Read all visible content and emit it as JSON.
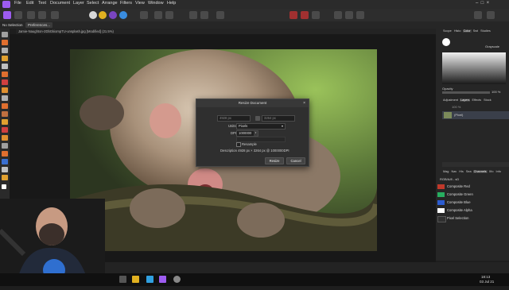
{
  "menu": [
    "File",
    "Edit",
    "Text",
    "Document",
    "Layer",
    "Select",
    "Arrange",
    "Filters",
    "View",
    "Window",
    "Help"
  ],
  "context": {
    "selection": "No Selection",
    "preferences": "Preferences..."
  },
  "tab": {
    "label": "Jamie-Naughton-2DbGkiompTU-unsplash.jpg [Modified] (21.5%)"
  },
  "dialog": {
    "title": "Resize Document",
    "close": "×",
    "width_value": "4928 px",
    "height_value": "3264 px",
    "units_label": "Units",
    "units_value": "Pixels",
    "dpi_label": "DPI",
    "dpi_value": "1000000",
    "resample_label": "Resample",
    "description": "Description 4928 px × 3264 px @ 1000000DPI",
    "resize_button": "Resize",
    "cancel_button": "Cancel"
  },
  "right": {
    "tabs1": [
      "Scope",
      "Histo",
      "Color",
      "Swt",
      "Studies"
    ],
    "grayscale": "Grayscale",
    "opacity_label": "Opacity",
    "opacity_value": "100 %",
    "tabs2": [
      "Adjustment",
      "Layers",
      "Effects",
      "Stock"
    ],
    "layer_opacity": "100 %",
    "layer_name": "(Pixel)",
    "tabs3": [
      "Mag",
      "Nav",
      "His",
      "Sea",
      "Channels",
      "Xfo",
      "Info"
    ],
    "rgb_label": "RGB/A/8 - sD",
    "channels": [
      {
        "name": "Composite Red",
        "color": "#c0392b"
      },
      {
        "name": "Composite Green",
        "color": "#27ae60"
      },
      {
        "name": "Composite Blue",
        "color": "#2c5cd0"
      },
      {
        "name": "Composite Alpha",
        "color": "#ffffff"
      },
      {
        "name": "Pixel Selection",
        "color": "#303030"
      }
    ]
  },
  "taskbar": {
    "time": "18:13",
    "date": "03 Jul 21"
  },
  "colors": {
    "accent": "#9d5cf0",
    "dialog_bg": "#2f2f2f"
  }
}
